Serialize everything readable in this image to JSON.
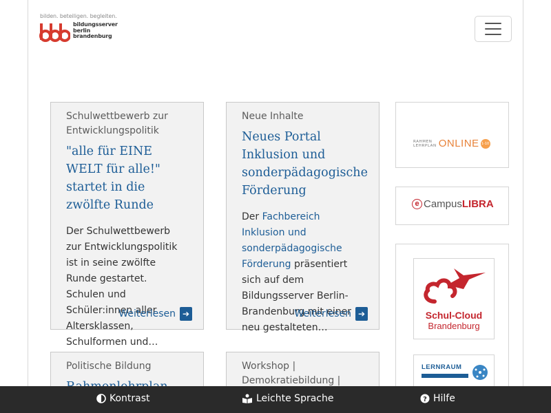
{
  "header": {
    "tagline": "bilden. beteiligen. begleiten.",
    "brand_lines": [
      "bildungsserver",
      "berlin",
      "brandenburg"
    ],
    "menu_icon": "hamburger-icon"
  },
  "cards": [
    {
      "kicker": "Schulwettbewerb zur Entwicklungspolitik",
      "title": "\"alle für EINE WELT für alle!\" startet in die zwölfte Runde",
      "body": "Der Schulwettbewerb zur Entwicklungspolitik ist in seine zwölfte Runde gestartet. Schulen und Schüler:innen aller Altersklassen, Schulformen und…",
      "more": "Weiterlesen"
    },
    {
      "kicker": "Neue Inhalte",
      "title": "Neues Portal Inklusion und sonderpädagogische Förderung",
      "body_prefix": "Der ",
      "body_link": "Fachbereich Inklusion und sonderpädagogische Förderung",
      "body_suffix": " präsentiert sich auf dem Bildungsserver Berlin-Brandenburg mit einer neu gestalteten…",
      "more": "Weiterlesen"
    },
    {
      "kicker": "Politische Bildung",
      "title": "Rahmenlehrplan für"
    },
    {
      "kicker": "Workshop | Demokratiebildung | Gleichstellung"
    }
  ],
  "sidebar": {
    "rahmenlehrplan": {
      "small_top": "RAHMEN",
      "small_bottom": "LEHRPLAN",
      "online": "ONLINE",
      "badge": "1-10"
    },
    "ecampus": {
      "e": "e",
      "campus": "Campus",
      "libra": "LIBRA"
    },
    "schulcloud": {
      "line1": "Schul-Cloud",
      "line2": "Brandenburg"
    },
    "lernraum": {
      "label": "LERNRAUM",
      "sub": "BERLIN"
    }
  },
  "footer": {
    "contrast": "Kontrast",
    "easy_language": "Leichte Sprache",
    "help": "Hilfe"
  },
  "colors": {
    "link": "#1d5d96",
    "brand_red": "#c4262e",
    "card_bg": "#f2f2f2",
    "footer_bg": "#2a2a2a",
    "orange": "#e8833a"
  }
}
